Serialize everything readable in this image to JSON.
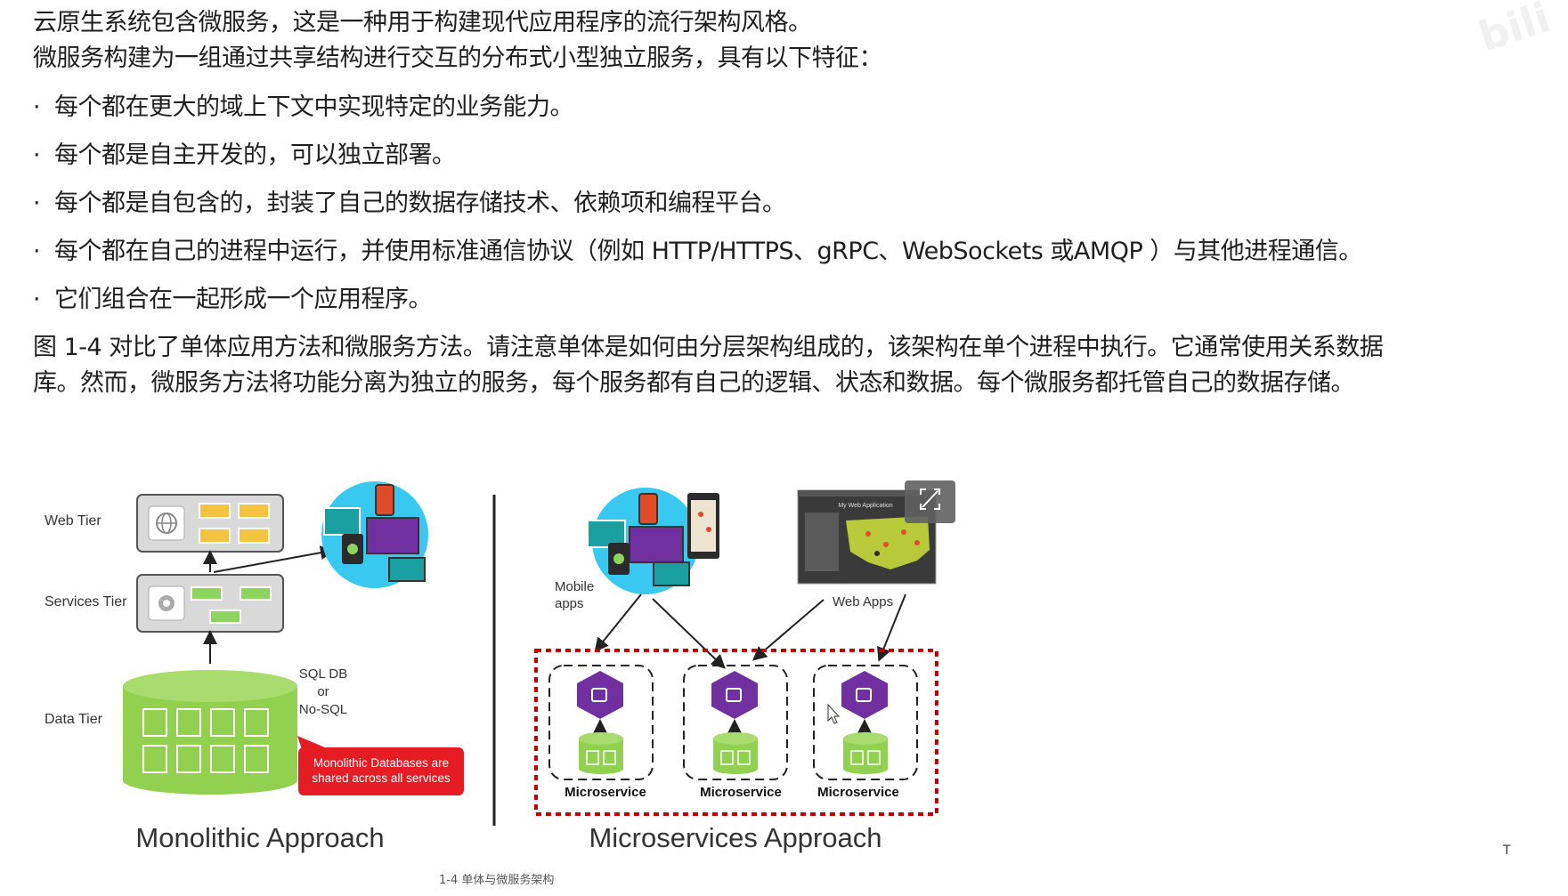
{
  "text": {
    "intro_line1": "云原生系统包含微服务，这是一种用于构建现代应用程序的流行架构风格。",
    "intro_line2": "微服务构建为一组通过共享结构进行交互的分布式小型独立服务，具有以下特征：",
    "bullets": [
      "每个都在更大的域上下文中实现特定的业务能力。",
      "每个都是自主开发的，可以独立部署。",
      "每个都是自包含的，封装了自己的数据存储技术、依赖项和编程平台。",
      "每个都在自己的进程中运行，并使用标准通信协议（例如 HTTP/HTTPS、gRPC、WebSockets 或AMQP ）与其他进程通信。",
      "它们组合在一起形成一个应用程序。"
    ],
    "bullet_symbol": "·",
    "para_line1": "图 1-4 对比了单体应用方法和微服务方法。请注意单体是如何由分层架构组成的，该架构在单个进程中执行。它通常使用关系数据",
    "para_line2": "库。然而，微服务方法将功能分离为独立的服务，每个服务都有自己的逻辑、状态和数据。每个微服务都托管自己的数据存储。"
  },
  "figure": {
    "monolithic": {
      "web_tier": "Web Tier",
      "services_tier": "Services Tier",
      "data_tier": "Data Tier",
      "sql_db_line1": "SQL DB",
      "sql_db_line2": "or",
      "sql_db_line3": "No-SQL",
      "callout_line1": "Monolithic Databases are",
      "callout_line2": "shared across all services",
      "title": "Monolithic Approach"
    },
    "microservices": {
      "mobile_line1": "Mobile",
      "mobile_line2": "apps",
      "web_apps": "Web Apps",
      "web_app_title": "My Web Application",
      "service_labels": [
        "Microservice",
        "Microservice",
        "Microservice"
      ],
      "title": "Microservices Approach"
    },
    "caption": "1-4 单体与微服务架构"
  },
  "watermark": "bili",
  "cursor_glyph": "T",
  "colors": {
    "tier_box": "#d9d9d9",
    "yellow": "#f5c342",
    "green": "#8ed461",
    "db_green": "#92d050",
    "red_callout": "#e51c23",
    "purple": "#7030a0",
    "cyan": "#38c8f0",
    "dashed_red": "#c00000"
  }
}
